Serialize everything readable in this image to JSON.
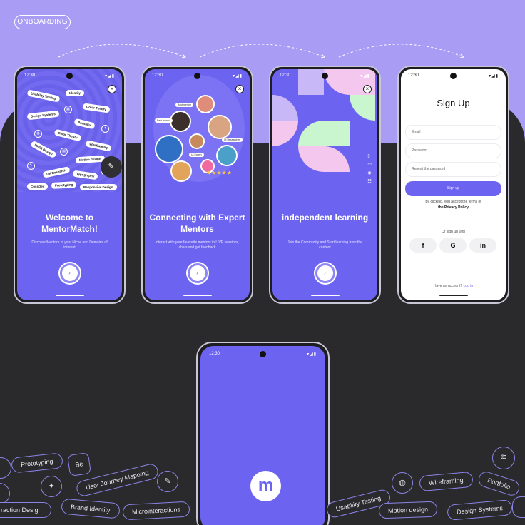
{
  "badge": "ONBOARDING",
  "status_time": "12:30",
  "status_icons": "▾◢▮",
  "screen1": {
    "title": "Welcome to MentorMatch!",
    "desc": "Discover Mentors of your Niche and Domains of interest",
    "chips": [
      "Usability Testing",
      "Identity",
      "Color Theory",
      "Design Systems",
      "Portfolio",
      "Color Theory",
      "Wireframing",
      "UX/UI Design",
      "Motion design",
      "UX Research",
      "Typography",
      "CossDev",
      "Prototyping",
      "Responsive Design"
    ],
    "next": "›"
  },
  "screen2": {
    "title": "Connecting with Expert Mentors",
    "desc": "Interact with your favourite mentors in LIVE sessions, chats and get feedback",
    "tags": [
      "Best mentor",
      "Best mentor",
      "UI Researcher",
      "UI Expert"
    ],
    "stars": "★★★★★",
    "next": "›"
  },
  "screen3": {
    "title": "independent learning",
    "desc": "Join the Community and Start learning from the content",
    "next": "›"
  },
  "signup": {
    "title": "Sign Up",
    "email": "Email",
    "password": "Password",
    "repeat": "Repeat the password",
    "button": "Sign up",
    "terms": "By clicking, you accept the terms of",
    "policy": "the Privacy Policy",
    "or": "Or sign up with",
    "social": [
      "f",
      "G",
      "in"
    ],
    "have": "Have an account?",
    "login": "Log in"
  },
  "splash": {
    "logo": "m",
    "fab": "✎"
  },
  "pills": {
    "prototyping": "Prototyping",
    "behance": "Bē",
    "journey": "User Journey Mapping",
    "brush": "✎",
    "interaction": "raction Design",
    "bulb": "✦",
    "brand": "Brand Identity",
    "micro": "Microinteractions",
    "usability": "Usability Testing",
    "dribbble": "◍",
    "wireframing": "Wireframing",
    "portfolio": "Portfolio",
    "motion": "Motion design",
    "design_systems": "Design Systems",
    "stack": "≋"
  },
  "colors": {
    "accent": "#6c63f0",
    "lilac": "#a99cf5",
    "dark": "#2a2a2c"
  }
}
